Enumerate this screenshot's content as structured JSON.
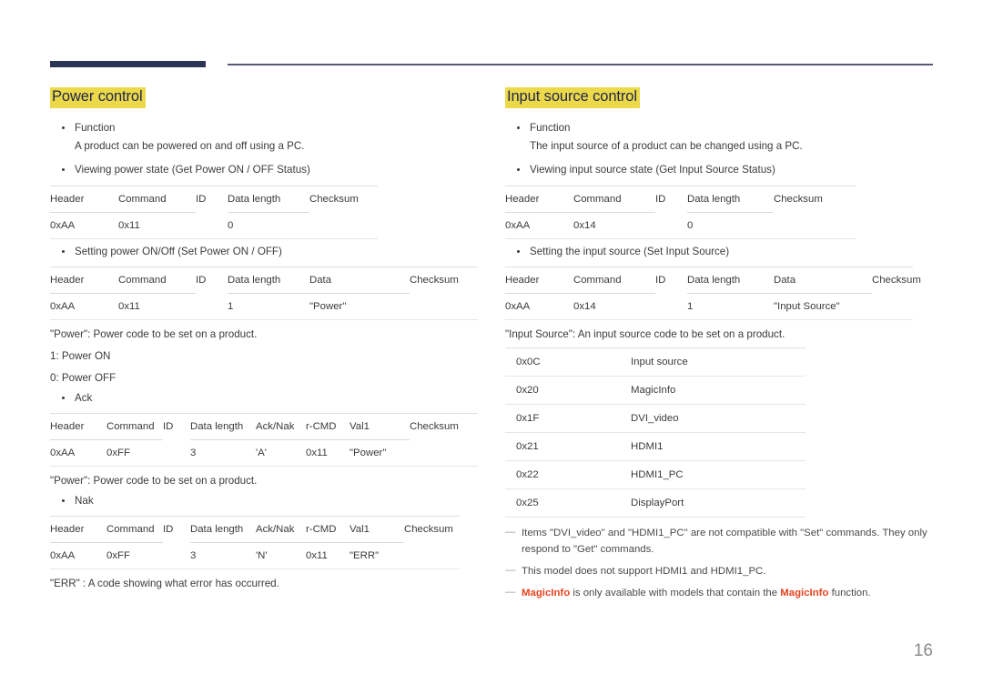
{
  "page": {
    "number": "16"
  },
  "left_column": {
    "heading": "Power control",
    "bullets": [
      {
        "title": "Function",
        "detail": "A product can be powered on and off using a PC."
      },
      {
        "title": "Viewing power state (Get Power ON / OFF Status)",
        "detail": ""
      }
    ],
    "get_table": {
      "headers": [
        "Header",
        "Command",
        "ID",
        "Data length",
        "Checksum"
      ],
      "rows": [
        [
          "0xAA",
          "0x11",
          "",
          "0",
          ""
        ]
      ]
    },
    "set_bullet": "Setting power ON/Off (Set Power ON / OFF)",
    "set_table": {
      "headers": [
        "Header",
        "Command",
        "ID",
        "Data length",
        "Data",
        "Checksum"
      ],
      "rows": [
        [
          "0xAA",
          "0x11",
          "",
          "1",
          "\"Power\"",
          ""
        ]
      ]
    },
    "power_note": "\"Power\": Power code to be set on a product.",
    "power_values": [
      "1: Power ON",
      "0: Power OFF"
    ],
    "ack_bullet": "Ack",
    "ack_table": {
      "headers": [
        "Header",
        "Command",
        "ID",
        "Data length",
        "Ack/Nak",
        "r-CMD",
        "Val1",
        "Checksum"
      ],
      "rows": [
        [
          "0xAA",
          "0xFF",
          "",
          "3",
          "'A'",
          "0x11",
          "\"Power\"",
          ""
        ]
      ]
    },
    "ack_note": "\"Power\": Power code to be set on a product.",
    "nak_bullet": "Nak",
    "nak_table": {
      "headers": [
        "Header",
        "Command",
        "ID",
        "Data length",
        "Ack/Nak",
        "r-CMD",
        "Val1",
        "Checksum"
      ],
      "rows": [
        [
          "0xAA",
          "0xFF",
          "",
          "3",
          "'N'",
          "0x11",
          "\"ERR\"",
          ""
        ]
      ]
    },
    "err_note": "\"ERR\" : A code showing what error has occurred."
  },
  "right_column": {
    "heading": "Input source control",
    "bullets": [
      {
        "title": "Function",
        "detail": "The input source of a product can be changed using a PC."
      },
      {
        "title": "Viewing input source state (Get Input Source Status)",
        "detail": ""
      }
    ],
    "get_table": {
      "headers": [
        "Header",
        "Command",
        "ID",
        "Data length",
        "Checksum"
      ],
      "rows": [
        [
          "0xAA",
          "0x14",
          "",
          "0",
          ""
        ]
      ]
    },
    "set_bullet": "Setting the input source (Set Input Source)",
    "set_table": {
      "headers": [
        "Header",
        "Command",
        "ID",
        "Data length",
        "Data",
        "Checksum"
      ],
      "rows": [
        [
          "0xAA",
          "0x14",
          "",
          "1",
          "\"Input Source\"",
          ""
        ]
      ]
    },
    "source_note": "\"Input Source\": An input source code to be set on a product.",
    "source_codes": [
      [
        "0x0C",
        "Input source"
      ],
      [
        "0x20",
        "MagicInfo"
      ],
      [
        "0x1F",
        "DVI_video"
      ],
      [
        "0x21",
        "HDMI1"
      ],
      [
        "0x22",
        "HDMI1_PC"
      ],
      [
        "0x25",
        "DisplayPort"
      ]
    ],
    "notes": [
      {
        "dash": "—",
        "segments": [
          {
            "text": "Items \"DVI_video\" and \"HDMI1_PC\" are not compatible with \"Set\" commands. They only respond to \"Get\" commands.",
            "accent": false
          }
        ]
      },
      {
        "dash": "—",
        "segments": [
          {
            "text": "This model does not support HDMI1 and HDMI1_PC.",
            "accent": false
          }
        ]
      },
      {
        "dash": "—",
        "segments": [
          {
            "text": "MagicInfo",
            "accent": true
          },
          {
            "text": " is only available with models that contain the ",
            "accent": false
          },
          {
            "text": "MagicInfo",
            "accent": true
          },
          {
            "text": " function.",
            "accent": false
          }
        ]
      }
    ]
  },
  "colors": {
    "heading_highlight": "#ecd94a",
    "heading_text": "#22274a",
    "header_bar": "#2b3555",
    "header_line": "#565a75",
    "accent": "#e8421f",
    "body_text": "#3b3b3b",
    "page_number": "#8b8b8b"
  }
}
